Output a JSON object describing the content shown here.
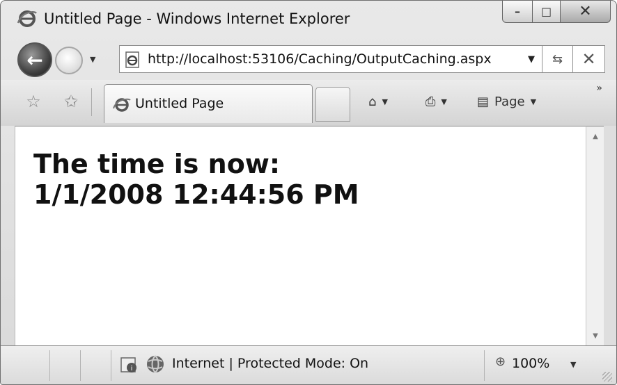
{
  "window": {
    "title": "Untitled Page - Windows Internet Explorer",
    "minimize_glyph": "–",
    "maximize_glyph": "□",
    "close_glyph": "✕"
  },
  "navigation": {
    "back_glyph": "←",
    "dropdown_glyph": "▼",
    "address": "http://localhost:53106/Caching/OutputCaching.aspx",
    "address_dropdown_glyph": "▼",
    "refresh_glyph": "⇆",
    "stop_glyph": "✕"
  },
  "command_bar": {
    "favorites_glyph": "☆",
    "add_favorites_glyph": "✩",
    "tab_label": "Untitled Page",
    "home_glyph": "⌂",
    "print_glyph": "⎙",
    "page_glyph": "▤",
    "page_label": "Page",
    "dropdown_glyph": "▼",
    "more_glyph": "»"
  },
  "content": {
    "line1": "The time is now:",
    "line2": "1/1/2008 12:44:56 PM"
  },
  "scrollbar": {
    "up_glyph": "▲",
    "down_glyph": "▼"
  },
  "statusbar": {
    "zone_text": "Internet | Protected Mode: On",
    "zoom_glyph": "⊕",
    "zoom": "100%",
    "zoom_dropdown_glyph": "▼"
  },
  "colors": {
    "chrome": "#d9d9d9",
    "content_background": "#ffffff",
    "text": "#111111"
  }
}
